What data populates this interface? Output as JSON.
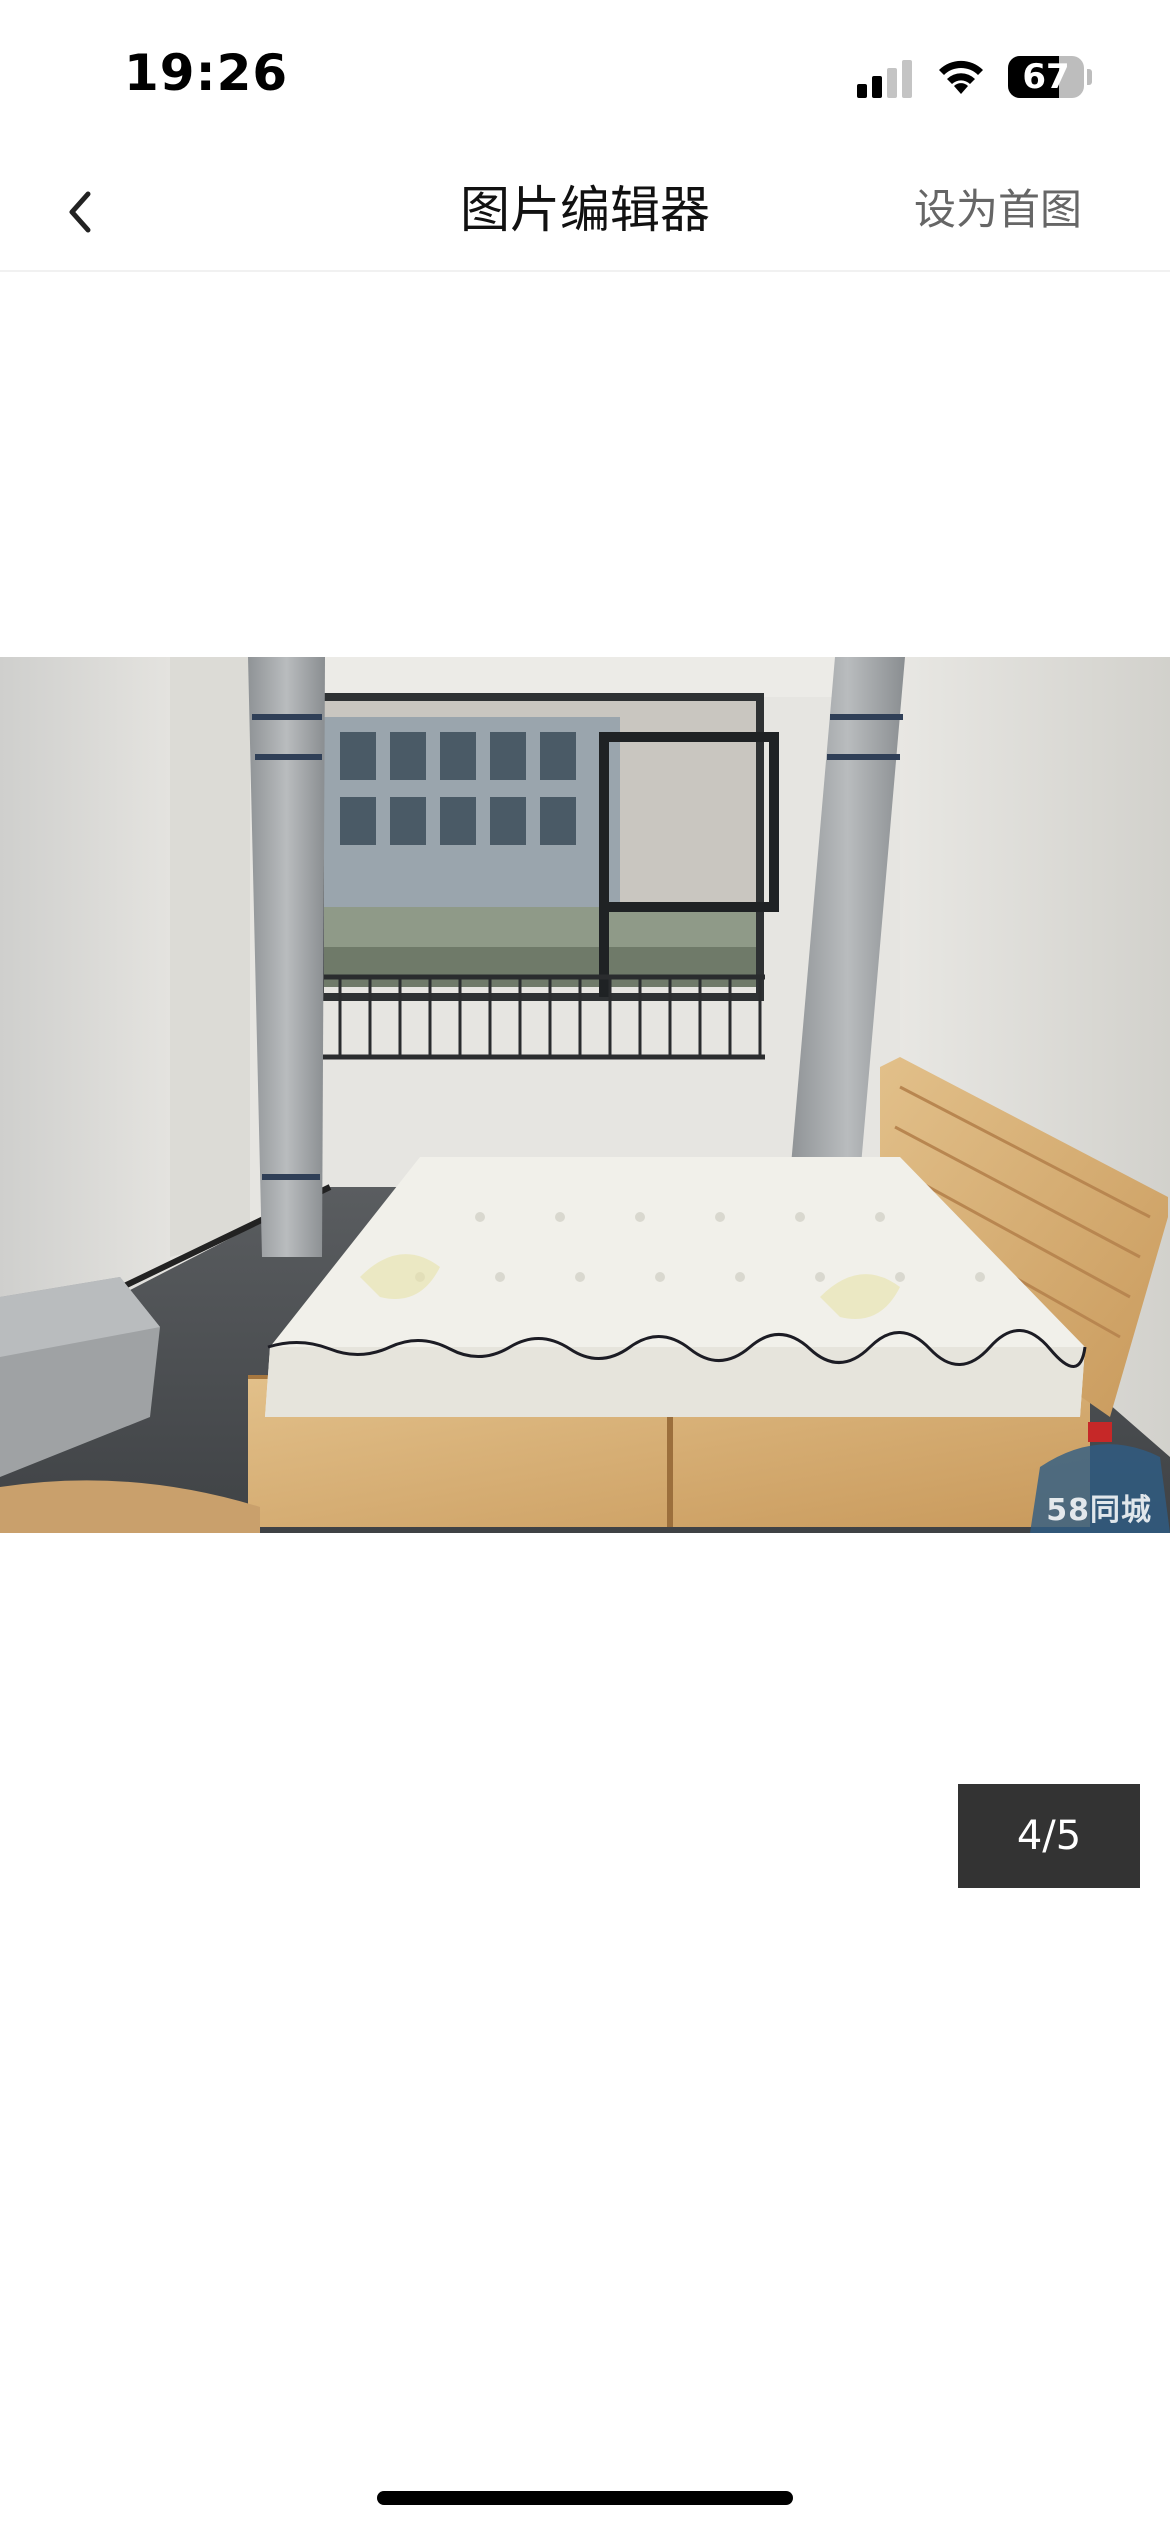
{
  "status_bar": {
    "time": "19:26",
    "battery_level": "67",
    "battery_fraction": 0.67,
    "signal_bars_active": 2,
    "signal_bars_total": 4,
    "icons": [
      "signal-icon",
      "wifi-icon",
      "battery-icon"
    ]
  },
  "nav": {
    "back_icon": "chevron-left-icon",
    "title": "图片编辑器",
    "action_label": "设为首图"
  },
  "photo": {
    "watermark": "58同城",
    "subject": "bedroom-photo"
  },
  "pager": {
    "counter": "4/5"
  },
  "colors": {
    "background": "#ffffff",
    "title_text": "#111111",
    "action_text": "#666666",
    "counter_bg": "#333333",
    "counter_text": "#ffffff"
  }
}
